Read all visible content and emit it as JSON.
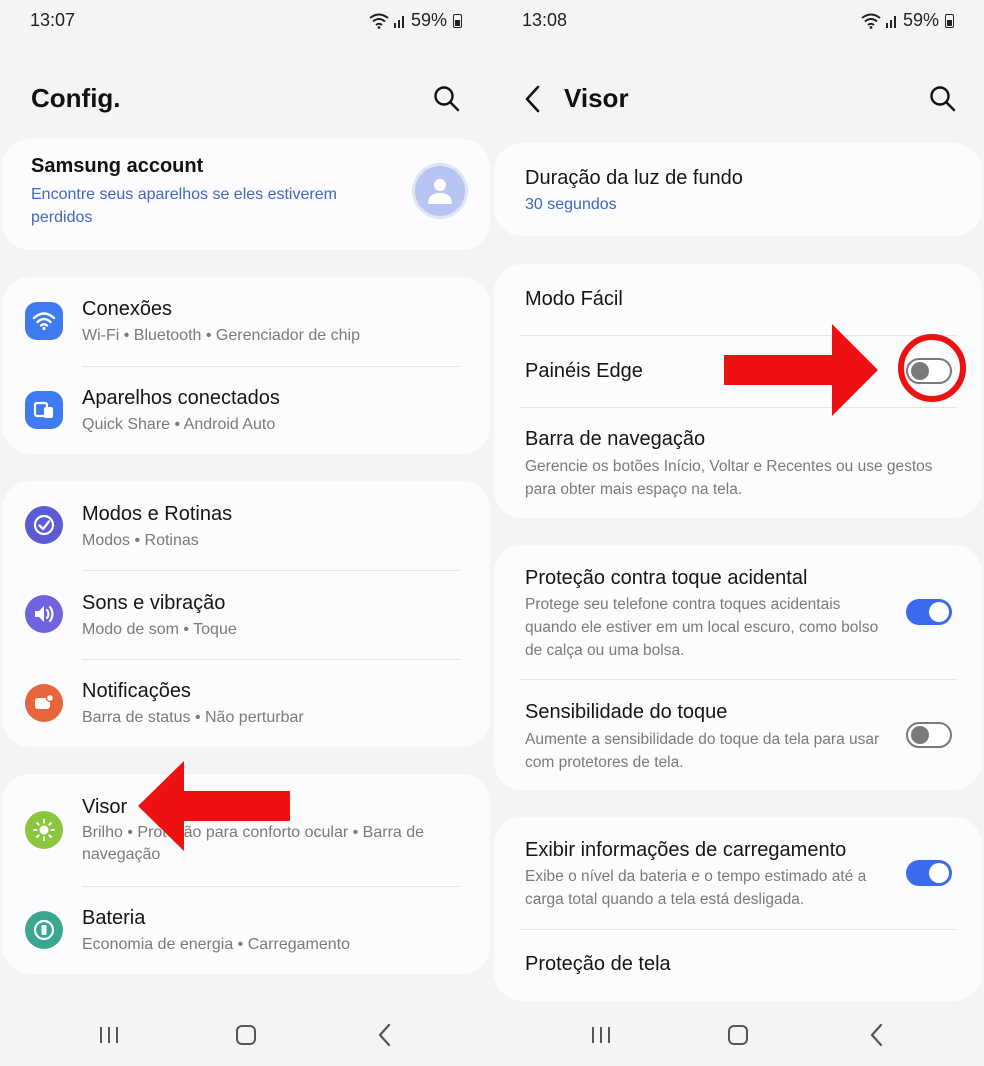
{
  "left": {
    "status": {
      "time": "13:07",
      "battery": "59%"
    },
    "header": {
      "title": "Config."
    },
    "account": {
      "title": "Samsung account",
      "subtitle": "Encontre seus aparelhos se eles estiverem perdidos"
    },
    "groups": [
      {
        "items": [
          {
            "title": "Conexões",
            "subtitle": "Wi-Fi  •  Bluetooth  •  Gerenciador de chip",
            "icon": "wifi-icon",
            "color": "#3e7bf2"
          },
          {
            "title": "Aparelhos conectados",
            "subtitle": "Quick Share  •  Android Auto",
            "icon": "devices-icon",
            "color": "#3e7bf2"
          }
        ]
      },
      {
        "items": [
          {
            "title": "Modos e Rotinas",
            "subtitle": "Modos  •  Rotinas",
            "icon": "modes-icon",
            "color": "#5b5bd6"
          },
          {
            "title": "Sons e vibração",
            "subtitle": "Modo de som  •  Toque",
            "icon": "sound-icon",
            "color": "#6f63e0"
          },
          {
            "title": "Notificações",
            "subtitle": "Barra de status  •  Não perturbar",
            "icon": "notification-icon",
            "color": "#e9663c"
          }
        ]
      },
      {
        "items": [
          {
            "title": "Visor",
            "subtitle": "Brilho  •  Proteção para conforto ocular  •  Barra de navegação",
            "icon": "brightness-icon",
            "color": "#8cc63f"
          },
          {
            "title": "Bateria",
            "subtitle": "Economia de energia  •  Carregamento",
            "icon": "battery-icon",
            "color": "#3aa891"
          }
        ]
      }
    ]
  },
  "right": {
    "status": {
      "time": "13:08",
      "battery": "59%"
    },
    "header": {
      "title": "Visor"
    },
    "backlight": {
      "title": "Duração da luz de fundo",
      "value": "30 segundos"
    },
    "group1": {
      "easy_mode": "Modo Fácil",
      "edge_panels": {
        "title": "Painéis Edge",
        "enabled": false
      },
      "nav_bar": {
        "title": "Barra de navegação",
        "subtitle": "Gerencie os botões Início, Voltar e Recentes ou use gestos para obter mais espaço na tela."
      }
    },
    "group2": {
      "accidental": {
        "title": "Proteção contra toque acidental",
        "subtitle": "Protege seu telefone contra toques acidentais quando ele estiver em um local escuro, como bolso de calça ou uma bolsa.",
        "enabled": true
      },
      "sensitivity": {
        "title": "Sensibilidade do toque",
        "subtitle": "Aumente a sensibilidade do toque da tela para usar com protetores de tela.",
        "enabled": false
      }
    },
    "group3": {
      "charging": {
        "title": "Exibir informações de carregamento",
        "subtitle": "Exibe o nível da bateria e o tempo estimado até a carga total quando a tela está desligada.",
        "enabled": true
      },
      "screensaver": {
        "title": "Proteção de tela"
      }
    }
  },
  "annotation_color": "#ee1111"
}
